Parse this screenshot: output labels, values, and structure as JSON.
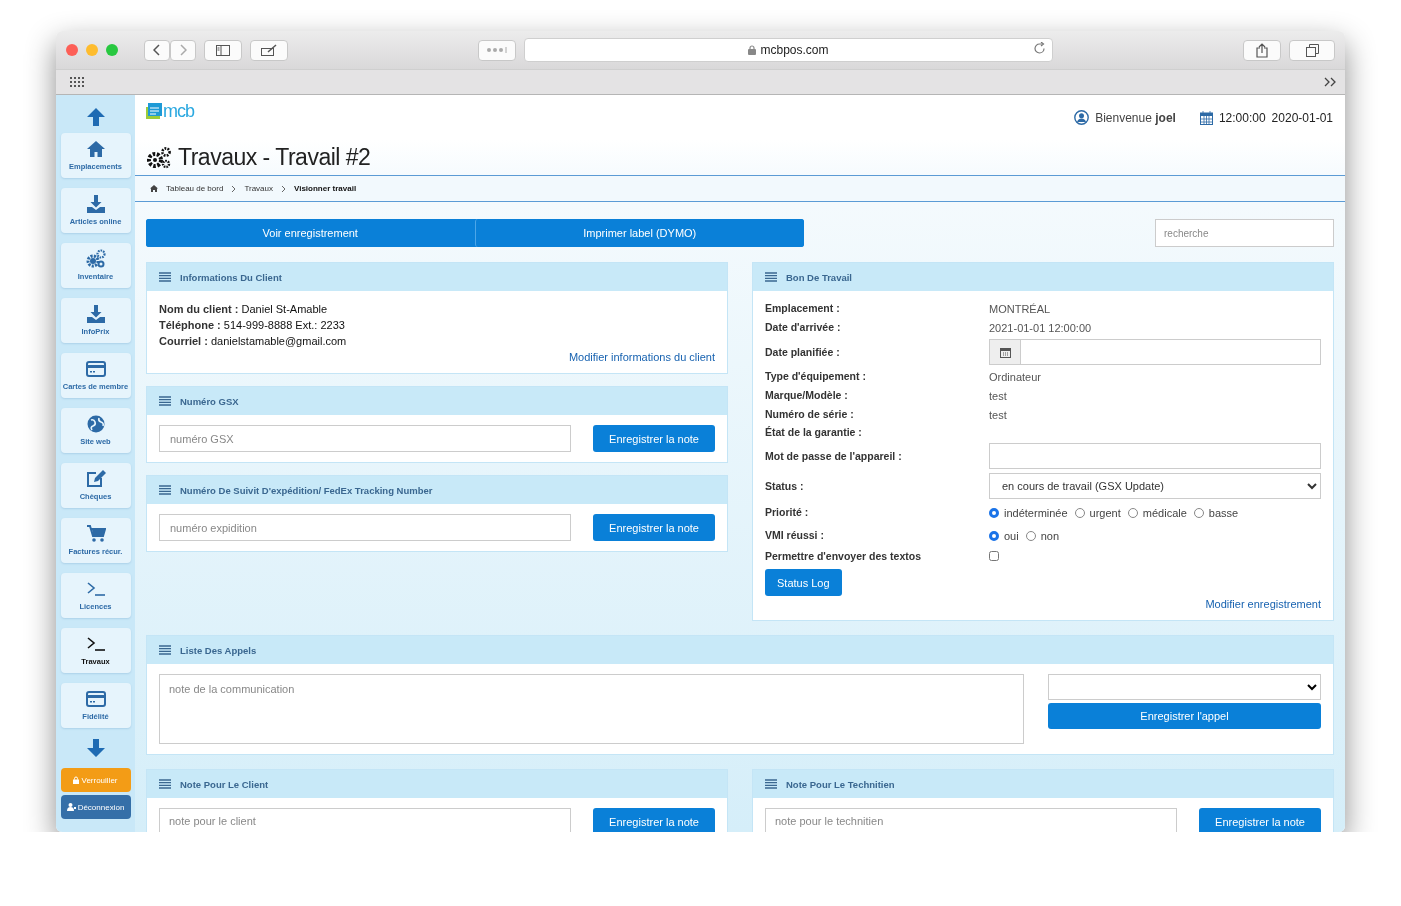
{
  "browser": {
    "url": "mcbpos.com"
  },
  "sidebar": {
    "items": [
      {
        "label": "Emplacements",
        "kind": "home",
        "selected": false
      },
      {
        "label": "Articles online",
        "kind": "download",
        "selected": false
      },
      {
        "label": "Inventaire",
        "kind": "gears",
        "selected": false
      },
      {
        "label": "InfoPrix",
        "kind": "download",
        "selected": false
      },
      {
        "label": "Cartes de membre",
        "kind": "card",
        "selected": false
      },
      {
        "label": "Site web",
        "kind": "globe",
        "selected": false
      },
      {
        "label": "Chèques",
        "kind": "edit",
        "selected": false
      },
      {
        "label": "Factures récur.",
        "kind": "cart",
        "selected": false
      },
      {
        "label": "Licences",
        "kind": "terminal",
        "selected": false
      },
      {
        "label": "Travaux",
        "kind": "terminal",
        "selected": true
      },
      {
        "label": "Fidélité",
        "kind": "card",
        "selected": false
      }
    ],
    "lock_button": "Verrouiller",
    "logout_button": "Déconnexion"
  },
  "header": {
    "logo": "mcb",
    "greeting": "Bienvenue **joel**",
    "time": "12:00:00",
    "date": "2020-01-01"
  },
  "title": "Travaux - Travail #2",
  "breadcrumb": [
    {
      "label": "Tableau de bord",
      "selected": false
    },
    {
      "label": "Travaux",
      "selected": false
    },
    {
      "label": "Visionner travail",
      "selected": true
    }
  ],
  "actions": [
    "Voir enregistrement",
    "Imprimer label (DYMO)"
  ],
  "search": {
    "placeholder": "recherche"
  },
  "client_panel": {
    "title": "Informations Du Client",
    "lines": [
      "**Nom du client :** Daniel St-Amable",
      "**Téléphone :** 514-999-8888 Ext.: 2233",
      "**Courriel :** danielstamable@gmail.com"
    ],
    "link": "Modifier informations du client"
  },
  "gsx_panel": {
    "title": "Numéro GSX",
    "placeholder": "numéro GSX",
    "button": "Enregistrer la note"
  },
  "tracking_panel": {
    "title": "Numéro De Suivit D'expédition/ FedEx Tracking Number",
    "placeholder": "numéro expidition",
    "button": "Enregistrer la note"
  },
  "work_order": {
    "title": "Bon De Travail",
    "fields": [
      {
        "kind": "text",
        "label": "Emplacement :",
        "value": "MONTRÉAL"
      },
      {
        "kind": "text",
        "label": "Date d'arrivée :",
        "value": "2021-01-01 12:00:00"
      },
      {
        "kind": "date",
        "label": "Date planifiée :"
      },
      {
        "kind": "text",
        "label": "Type d'équipement :",
        "value": "Ordinateur"
      },
      {
        "kind": "text",
        "label": "Marque/Modèle :",
        "value": "test"
      },
      {
        "kind": "text",
        "label": "Numéro de série :",
        "value": "test"
      },
      {
        "kind": "text",
        "label": "État de la garantie :"
      },
      {
        "kind": "input",
        "label": "Mot de passe de l'appareil :"
      },
      {
        "kind": "select",
        "label": "Status :",
        "value": "en cours de travail (GSX Update)"
      },
      {
        "kind": "radio",
        "label": "Priorité :",
        "options": [
          {
            "label": "indéterminée",
            "selected": true
          },
          {
            "label": "urgent",
            "selected": false
          },
          {
            "label": "médicale",
            "selected": false
          },
          {
            "label": "basse",
            "selected": false
          }
        ]
      },
      {
        "kind": "radio",
        "label": "VMI réussi :",
        "options": [
          {
            "label": "oui",
            "selected": true
          },
          {
            "label": "non",
            "selected": false
          }
        ]
      },
      {
        "kind": "checkbox",
        "label": "Permettre d'envoyer des textos",
        "checked": false
      }
    ],
    "button": "Status Log",
    "link": "Modifier enregistrement"
  },
  "calls_panel": {
    "title": "Liste Des Appels",
    "placeholder": "note de la communication",
    "button": "Enregistrer l'appel"
  },
  "client_note": {
    "title": "Note Pour Le Client",
    "placeholder": "note pour le client",
    "button": "Enregistrer la note"
  },
  "tech_note": {
    "title": "Note Pour Le Technitien",
    "placeholder": "note pour le technitien",
    "button": "Enregistrer la note"
  }
}
